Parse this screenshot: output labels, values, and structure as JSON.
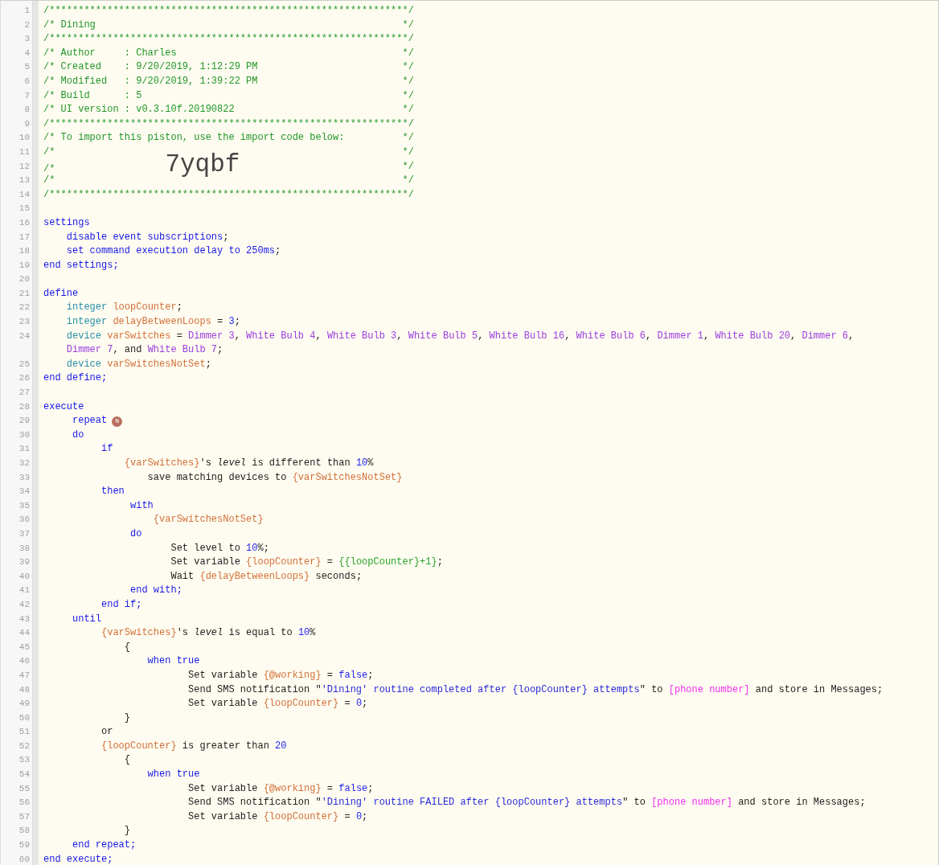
{
  "lines": [
    {
      "number": "1",
      "tokens": [
        {
          "kind": "comment",
          "text": "/**************************************************************/"
        }
      ]
    },
    {
      "number": "2",
      "tokens": [
        {
          "kind": "comment",
          "text": "/* Dining"
        }
      ],
      "close": "*/"
    },
    {
      "number": "3",
      "tokens": [
        {
          "kind": "comment",
          "text": "/**************************************************************/"
        }
      ]
    },
    {
      "number": "4",
      "tokens": [
        {
          "kind": "comment",
          "text": "/* Author     : Charles"
        }
      ],
      "close": "*/"
    },
    {
      "number": "5",
      "tokens": [
        {
          "kind": "comment",
          "text": "/* Created    : 9/20/2019, 1:12:29 PM"
        }
      ],
      "close": "*/"
    },
    {
      "number": "6",
      "tokens": [
        {
          "kind": "comment",
          "text": "/* Modified   : 9/20/2019, 1:39:22 PM"
        }
      ],
      "close": "*/"
    },
    {
      "number": "7",
      "tokens": [
        {
          "kind": "comment",
          "text": "/* Build      : 5"
        }
      ],
      "close": "*/"
    },
    {
      "number": "8",
      "tokens": [
        {
          "kind": "comment",
          "text": "/* UI version : v0.3.10f.20190822"
        }
      ],
      "close": "*/"
    },
    {
      "number": "9",
      "tokens": [
        {
          "kind": "comment",
          "text": "/**************************************************************/"
        }
      ]
    },
    {
      "number": "10",
      "tokens": [
        {
          "kind": "comment",
          "text": "/* To import this piston, use the import code below:"
        }
      ],
      "close": "*/"
    },
    {
      "number": "11",
      "tokens": [
        {
          "kind": "comment",
          "text": "/*"
        }
      ],
      "close": "*/"
    },
    {
      "number": "12",
      "tokens": [
        {
          "kind": "comment",
          "text": "/*"
        },
        {
          "kind": "code",
          "text": "7yqbf"
        }
      ],
      "close": "*/"
    },
    {
      "number": "13",
      "tokens": [
        {
          "kind": "comment",
          "text": "/*"
        }
      ],
      "close": "*/"
    },
    {
      "number": "14",
      "tokens": [
        {
          "kind": "comment",
          "text": "/**************************************************************/"
        }
      ]
    },
    {
      "number": "15"
    },
    {
      "number": "16",
      "tokens": [
        {
          "kind": "keyword",
          "text": "settings"
        }
      ]
    },
    {
      "number": "17",
      "tokens": [
        {
          "kind": "keyword",
          "text": "    disable event subscriptions"
        },
        {
          "kind": "plain",
          "text": ";"
        }
      ]
    },
    {
      "number": "18",
      "tokens": [
        {
          "kind": "keyword",
          "text": "    set command execution delay to 250ms"
        },
        {
          "kind": "plain",
          "text": ";"
        }
      ]
    },
    {
      "number": "19",
      "tokens": [
        {
          "kind": "keyword",
          "text": "end settings;"
        }
      ]
    },
    {
      "number": "20"
    },
    {
      "number": "21",
      "tokens": [
        {
          "kind": "keyword",
          "text": "define"
        }
      ]
    },
    {
      "number": "22",
      "tokens": [
        {
          "kind": "type",
          "text": "    integer "
        },
        {
          "kind": "var",
          "text": "loopCounter"
        },
        {
          "kind": "plain",
          "text": ";"
        }
      ]
    },
    {
      "number": "23",
      "tokens": [
        {
          "kind": "type",
          "text": "    integer "
        },
        {
          "kind": "var",
          "text": "delayBetweenLoops"
        },
        {
          "kind": "plain",
          "text": " = "
        },
        {
          "kind": "number",
          "text": "3"
        },
        {
          "kind": "plain",
          "text": ";"
        }
      ]
    },
    {
      "number": "24",
      "tokens": [
        {
          "kind": "type",
          "text": "    device "
        },
        {
          "kind": "var",
          "text": "varSwitches"
        },
        {
          "kind": "plain",
          "text": " = "
        },
        {
          "kind": "device",
          "text": "Dimmer 3"
        },
        {
          "kind": "plain",
          "text": ", "
        },
        {
          "kind": "device",
          "text": "White Bulb 4"
        },
        {
          "kind": "plain",
          "text": ", "
        },
        {
          "kind": "device",
          "text": "White Bulb 3"
        },
        {
          "kind": "plain",
          "text": ", "
        },
        {
          "kind": "device",
          "text": "White Bulb 5"
        },
        {
          "kind": "plain",
          "text": ", "
        },
        {
          "kind": "device",
          "text": "White Bulb 16"
        },
        {
          "kind": "plain",
          "text": ", "
        },
        {
          "kind": "device",
          "text": "White Bulb 6"
        },
        {
          "kind": "plain",
          "text": ", "
        },
        {
          "kind": "device",
          "text": "Dimmer 1"
        },
        {
          "kind": "plain",
          "text": ", "
        },
        {
          "kind": "device",
          "text": "White Bulb 20"
        },
        {
          "kind": "plain",
          "text": ", "
        },
        {
          "kind": "device",
          "text": "Dimmer 6"
        },
        {
          "kind": "plain",
          "text": ","
        }
      ]
    },
    {
      "tokens": [
        {
          "kind": "device",
          "text": "    Dimmer 7"
        },
        {
          "kind": "plain",
          "text": ", and "
        },
        {
          "kind": "device",
          "text": "White Bulb 7"
        },
        {
          "kind": "plain",
          "text": ";"
        }
      ]
    },
    {
      "number": "25",
      "tokens": [
        {
          "kind": "type",
          "text": "    device "
        },
        {
          "kind": "var",
          "text": "varSwitchesNotSet"
        },
        {
          "kind": "plain",
          "text": ";"
        }
      ]
    },
    {
      "number": "26",
      "tokens": [
        {
          "kind": "keyword",
          "text": "end define;"
        }
      ]
    },
    {
      "number": "27"
    },
    {
      "number": "28",
      "tokens": [
        {
          "kind": "keyword",
          "text": "execute"
        }
      ]
    },
    {
      "number": "29",
      "tokens": [
        {
          "kind": "keyword",
          "text": "     repeat"
        },
        {
          "kind": "badge",
          "text": "N"
        }
      ]
    },
    {
      "number": "30",
      "tokens": [
        {
          "kind": "keyword",
          "text": "     do"
        }
      ]
    },
    {
      "number": "31",
      "tokens": [
        {
          "kind": "keyword",
          "text": "          if"
        }
      ]
    },
    {
      "number": "32",
      "tokens": [
        {
          "kind": "var",
          "text": "              {varSwitches}"
        },
        {
          "kind": "plain",
          "text": "'s "
        },
        {
          "kind": "italic",
          "text": "level"
        },
        {
          "kind": "plain",
          "text": " is different than "
        },
        {
          "kind": "number",
          "text": "10"
        },
        {
          "kind": "plain",
          "text": "%"
        }
      ]
    },
    {
      "number": "33",
      "tokens": [
        {
          "kind": "plain",
          "text": "                  save matching devices to "
        },
        {
          "kind": "var",
          "text": "{varSwitchesNotSet}"
        }
      ]
    },
    {
      "number": "34",
      "tokens": [
        {
          "kind": "keyword",
          "text": "          then"
        }
      ]
    },
    {
      "number": "35",
      "tokens": [
        {
          "kind": "keyword",
          "text": "               with"
        }
      ]
    },
    {
      "number": "36",
      "tokens": [
        {
          "kind": "var",
          "text": "                   {varSwitchesNotSet}"
        }
      ]
    },
    {
      "number": "37",
      "tokens": [
        {
          "kind": "keyword",
          "text": "               do"
        }
      ]
    },
    {
      "number": "38",
      "tokens": [
        {
          "kind": "plain",
          "text": "                      Set level to "
        },
        {
          "kind": "number",
          "text": "10"
        },
        {
          "kind": "plain",
          "text": "%;"
        }
      ]
    },
    {
      "number": "39",
      "tokens": [
        {
          "kind": "plain",
          "text": "                      Set variable "
        },
        {
          "kind": "var",
          "text": "{loopCounter}"
        },
        {
          "kind": "plain",
          "text": " = "
        },
        {
          "kind": "expr",
          "text": "{{loopCounter}+1}"
        },
        {
          "kind": "plain",
          "text": ";"
        }
      ]
    },
    {
      "number": "40",
      "tokens": [
        {
          "kind": "plain",
          "text": "                      Wait "
        },
        {
          "kind": "var",
          "text": "{delayBetweenLoops}"
        },
        {
          "kind": "plain",
          "text": " seconds;"
        }
      ]
    },
    {
      "number": "41",
      "tokens": [
        {
          "kind": "keyword",
          "text": "               end with;"
        }
      ]
    },
    {
      "number": "42",
      "tokens": [
        {
          "kind": "keyword",
          "text": "          end if;"
        }
      ]
    },
    {
      "number": "43",
      "tokens": [
        {
          "kind": "keyword",
          "text": "     until"
        }
      ]
    },
    {
      "number": "44",
      "tokens": [
        {
          "kind": "var",
          "text": "          {varSwitches}"
        },
        {
          "kind": "plain",
          "text": "'s "
        },
        {
          "kind": "italic",
          "text": "level"
        },
        {
          "kind": "plain",
          "text": " is equal to "
        },
        {
          "kind": "number",
          "text": "10"
        },
        {
          "kind": "plain",
          "text": "%"
        }
      ]
    },
    {
      "number": "45",
      "tokens": [
        {
          "kind": "plain",
          "text": "              {"
        }
      ]
    },
    {
      "number": "46",
      "tokens": [
        {
          "kind": "keyword",
          "text": "                  when true"
        }
      ]
    },
    {
      "number": "47",
      "tokens": [
        {
          "kind": "plain",
          "text": "                         Set variable "
        },
        {
          "kind": "var",
          "text": "{@working}"
        },
        {
          "kind": "plain",
          "text": " = "
        },
        {
          "kind": "number",
          "text": "false"
        },
        {
          "kind": "plain",
          "text": ";"
        }
      ]
    },
    {
      "number": "48",
      "tokens": [
        {
          "kind": "plain",
          "text": "                         Send SMS notification \""
        },
        {
          "kind": "string",
          "text": "'Dining' routine completed after {loopCounter} attempts"
        },
        {
          "kind": "plain",
          "text": "\" to "
        },
        {
          "kind": "phone",
          "text": "[phone number]"
        },
        {
          "kind": "plain",
          "text": " and store in Messages;"
        }
      ]
    },
    {
      "number": "49",
      "tokens": [
        {
          "kind": "plain",
          "text": "                         Set variable "
        },
        {
          "kind": "var",
          "text": "{loopCounter}"
        },
        {
          "kind": "plain",
          "text": " = "
        },
        {
          "kind": "number",
          "text": "0"
        },
        {
          "kind": "plain",
          "text": ";"
        }
      ]
    },
    {
      "number": "50",
      "tokens": [
        {
          "kind": "plain",
          "text": "              }"
        }
      ]
    },
    {
      "number": "51",
      "tokens": [
        {
          "kind": "plain",
          "text": "          or"
        }
      ]
    },
    {
      "number": "52",
      "tokens": [
        {
          "kind": "var",
          "text": "          {loopCounter}"
        },
        {
          "kind": "plain",
          "text": " is greater than "
        },
        {
          "kind": "number",
          "text": "20"
        }
      ]
    },
    {
      "number": "53",
      "tokens": [
        {
          "kind": "plain",
          "text": "              {"
        }
      ]
    },
    {
      "number": "54",
      "tokens": [
        {
          "kind": "keyword",
          "text": "                  when true"
        }
      ]
    },
    {
      "number": "55",
      "tokens": [
        {
          "kind": "plain",
          "text": "                         Set variable "
        },
        {
          "kind": "var",
          "text": "{@working}"
        },
        {
          "kind": "plain",
          "text": " = "
        },
        {
          "kind": "number",
          "text": "false"
        },
        {
          "kind": "plain",
          "text": ";"
        }
      ]
    },
    {
      "number": "56",
      "tokens": [
        {
          "kind": "plain",
          "text": "                         Send SMS notification \""
        },
        {
          "kind": "string",
          "text": "'Dining' routine FAILED after {loopCounter} attempts"
        },
        {
          "kind": "plain",
          "text": "\" to "
        },
        {
          "kind": "phone",
          "text": "[phone number]"
        },
        {
          "kind": "plain",
          "text": " and store in Messages;"
        }
      ]
    },
    {
      "number": "57",
      "tokens": [
        {
          "kind": "plain",
          "text": "                         Set variable "
        },
        {
          "kind": "var",
          "text": "{loopCounter}"
        },
        {
          "kind": "plain",
          "text": " = "
        },
        {
          "kind": "number",
          "text": "0"
        },
        {
          "kind": "plain",
          "text": ";"
        }
      ]
    },
    {
      "number": "58",
      "tokens": [
        {
          "kind": "plain",
          "text": "              }"
        }
      ]
    },
    {
      "number": "59",
      "tokens": [
        {
          "kind": "keyword",
          "text": "     end repeat;"
        }
      ]
    },
    {
      "number": "60",
      "tokens": [
        {
          "kind": "keyword",
          "text": "end execute;"
        }
      ]
    }
  ]
}
